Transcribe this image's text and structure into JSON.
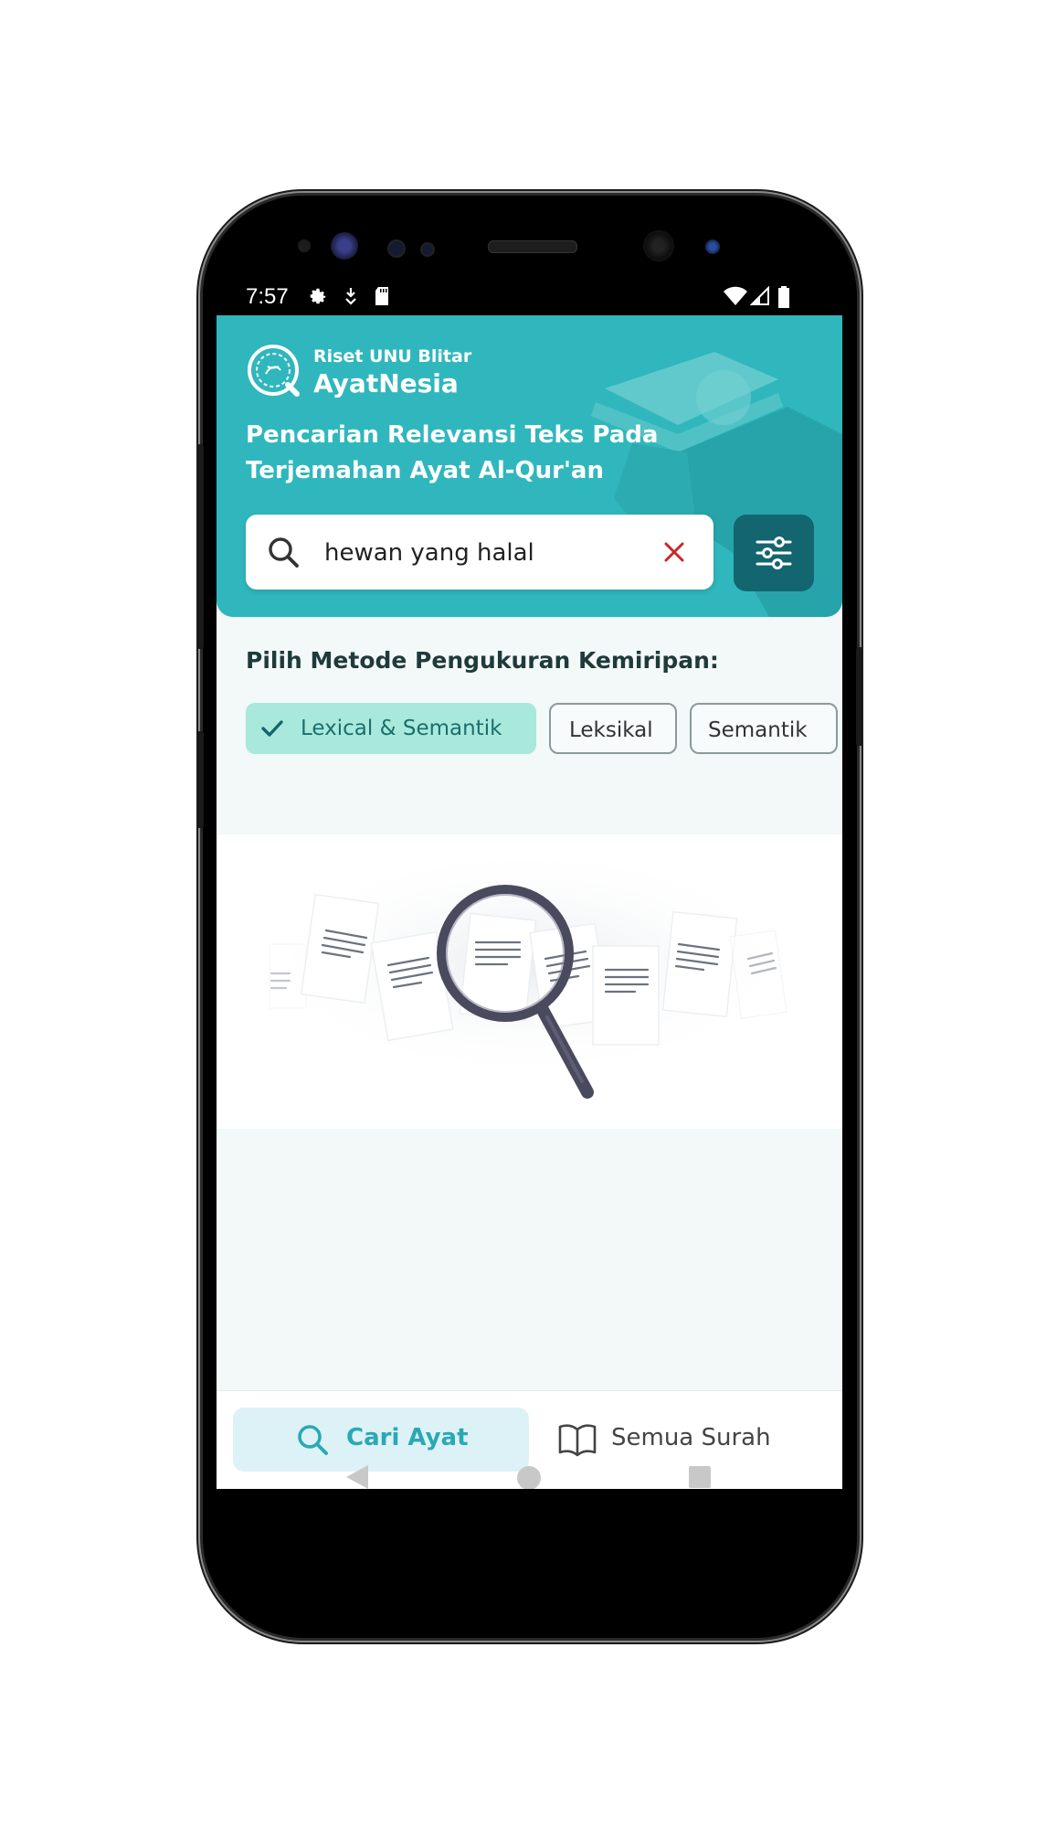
{
  "status_bar": {
    "time": "7:57",
    "left_icons": [
      "settings-icon",
      "download-icon",
      "sd-card-icon"
    ],
    "right_icons": [
      "wifi-icon",
      "signal-icon",
      "battery-icon"
    ]
  },
  "header": {
    "brand_subtitle": "Riset UNU Blitar",
    "brand_title": "AyatNesia",
    "tagline": "Pencarian Relevansi Teks Pada Terjemahan Ayat Al-Qur'an",
    "background_color": "#2fb7bd"
  },
  "search": {
    "value": "hewan yang halal",
    "search_icon": "search-icon",
    "clear_icon": "close-icon",
    "filter_icon": "sliders-icon"
  },
  "method": {
    "label": "Pilih Metode Pengukuran Kemiripan:",
    "options": [
      {
        "label": "Lexical & Semantik",
        "selected": true
      },
      {
        "label": "Leksikal",
        "selected": false
      },
      {
        "label": "Semantik",
        "selected": false
      }
    ]
  },
  "illustration": {
    "icon": "magnifier-documents-illustration"
  },
  "bottom_nav": {
    "items": [
      {
        "label": "Cari Ayat",
        "icon": "search-icon",
        "active": true
      },
      {
        "label": "Semua Surah",
        "icon": "book-open-icon",
        "active": false
      }
    ]
  },
  "system_nav": {
    "buttons": [
      "back-icon",
      "home-icon",
      "recents-icon"
    ]
  },
  "colors": {
    "accent": "#2fb7bd",
    "dark_accent": "#136570",
    "chip_selected_bg": "#a9e9dc",
    "nav_active_bg": "#ddf2f6"
  }
}
